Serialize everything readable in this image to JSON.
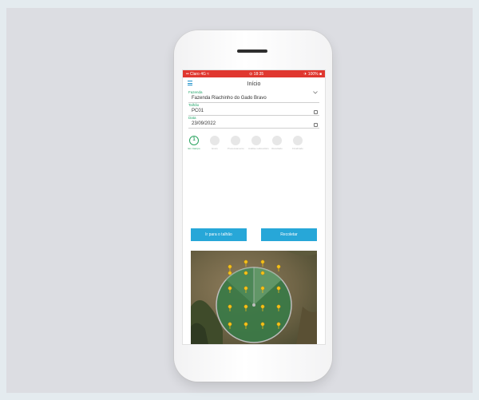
{
  "status": {
    "carrier": "•• Claro 4G ≈",
    "time": "⊙ 18:35",
    "battery": "✈ 100% ■"
  },
  "header": {
    "title": "Início",
    "menu_icon": "hamburger-menu-icon"
  },
  "fields": [
    {
      "label": "Fazenda",
      "value": "Fazenda Riachinho do Gado Bravo",
      "icon": "dropdown-chevron-icon"
    },
    {
      "label": "Talhão",
      "value": "PC01",
      "icon": "calendar-icon"
    },
    {
      "label": "Data",
      "value": "23/09/2022",
      "icon": "calendar-icon"
    }
  ],
  "steps": [
    {
      "number": "1",
      "label": "Em Campo",
      "active": true
    },
    {
      "number": "",
      "label": "Envio",
      "active": false
    },
    {
      "number": "",
      "label": "Processamento",
      "active": false
    },
    {
      "number": "",
      "label": "Análise Laboratório",
      "active": false
    },
    {
      "number": "",
      "label": "Resultado",
      "active": false
    },
    {
      "number": "",
      "label": "Finalizado",
      "active": false
    }
  ],
  "buttons": {
    "goto_plot": "Ir para o talhão",
    "recollect": "Recoletar"
  },
  "colors": {
    "status_bar": "#e0372f",
    "accent_blue": "#27a7d8",
    "accent_green": "#23a66a",
    "marker": "#f4c21a"
  }
}
